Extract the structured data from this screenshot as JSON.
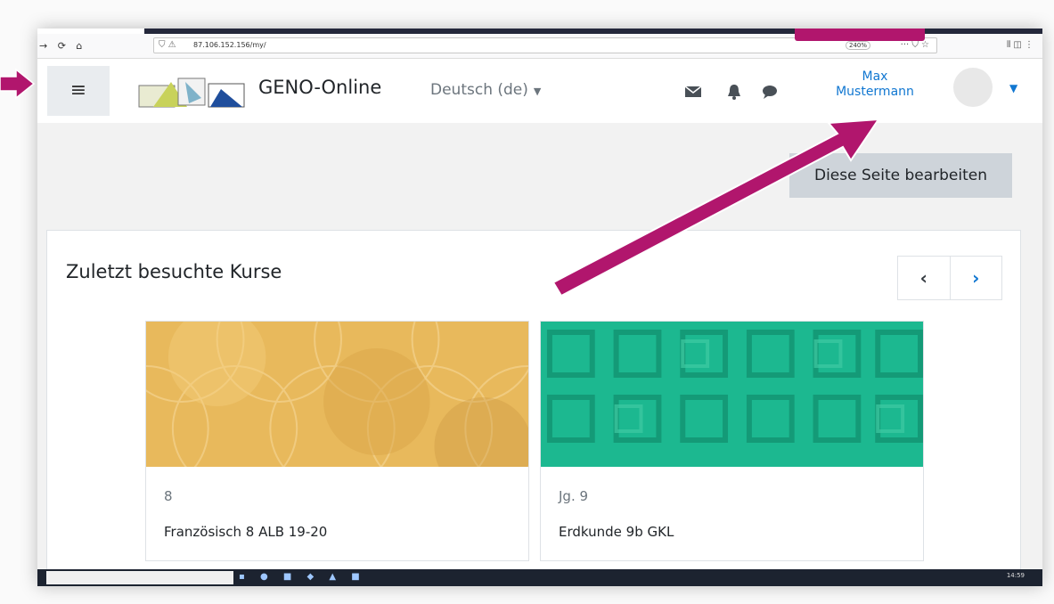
{
  "browser": {
    "url": "87.106.152.156/my/",
    "zoom": "240%"
  },
  "header": {
    "site_name": "GENO-Online",
    "language": "Deutsch (de)",
    "user_name_line1": "Max",
    "user_name_line2": "Mustermann"
  },
  "page": {
    "edit_button": "Diese Seite bearbeiten",
    "block_title": "Zuletzt besuchte Kurse"
  },
  "courses": [
    {
      "category": "8",
      "name": "Französisch 8 ALB 19-20",
      "image_color": "#e8b95c"
    },
    {
      "category": "Jg. 9",
      "name": "Erdkunde 9b GKL",
      "image_color": "#1cb890"
    }
  ],
  "taskbar": {
    "time": "14:59"
  },
  "colors": {
    "accent_link": "#1177d1",
    "annotation_arrow": "#b1166d",
    "edit_button_bg": "#ced4da"
  },
  "icons": [
    "hamburger-icon",
    "mail-icon",
    "bell-icon",
    "chat-icon",
    "chevron-left-icon",
    "chevron-right-icon",
    "caret-down-icon"
  ]
}
